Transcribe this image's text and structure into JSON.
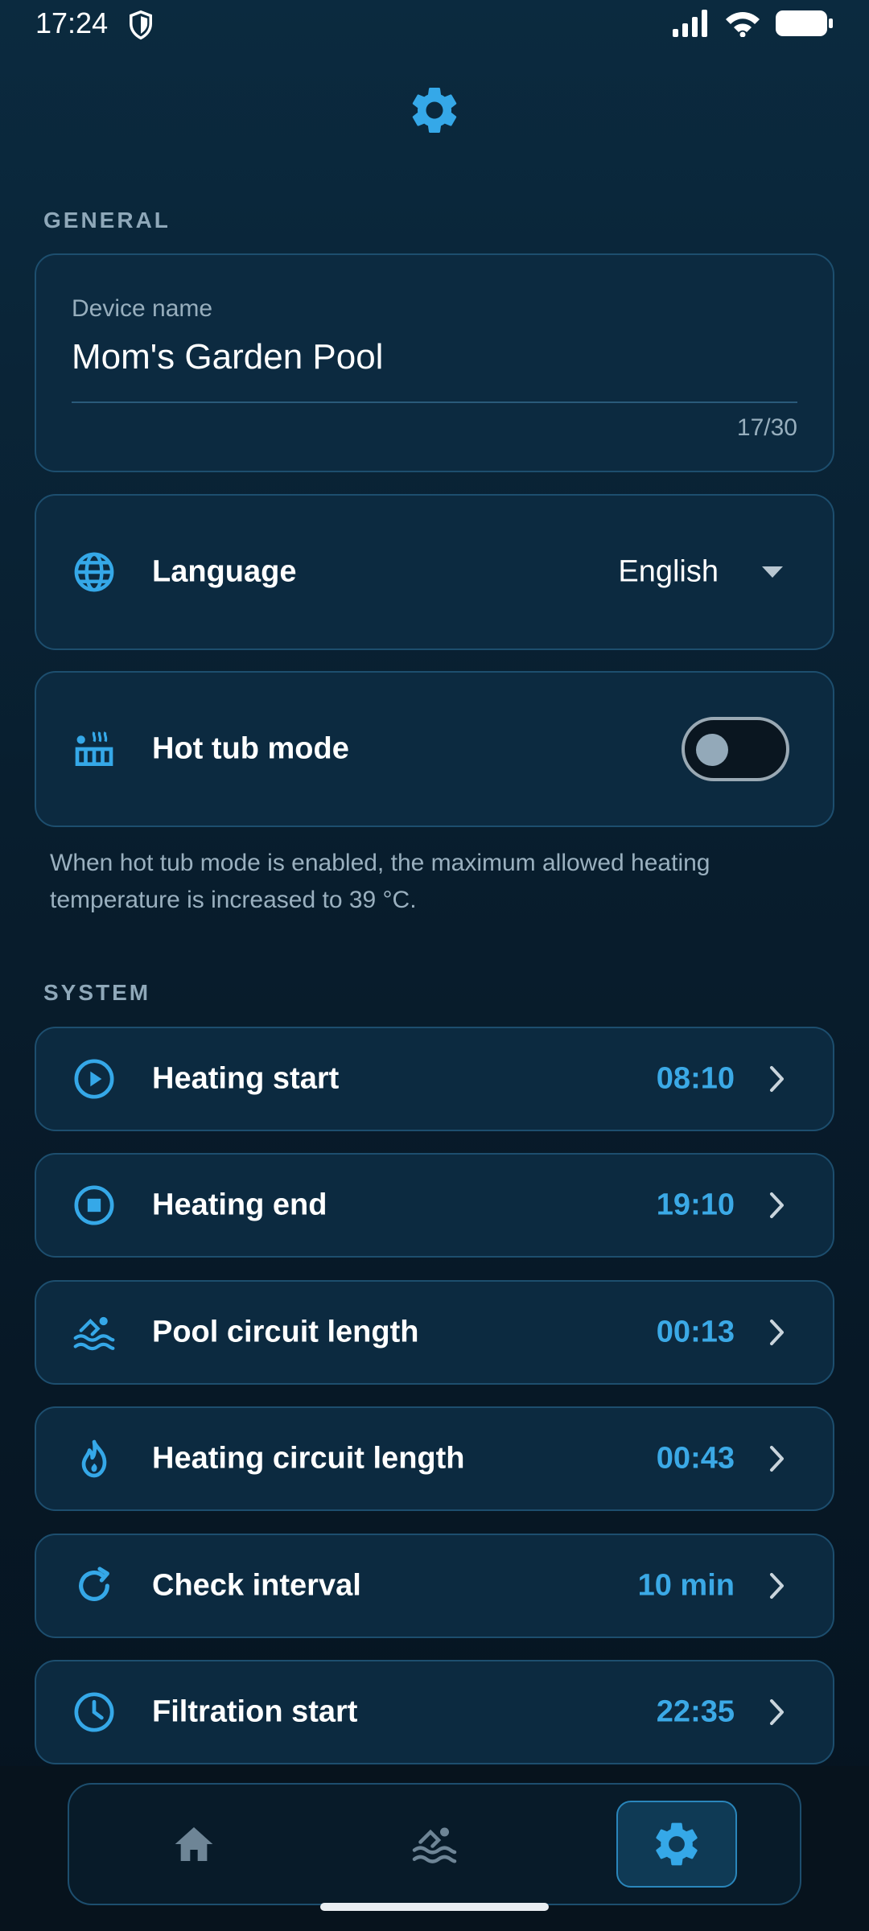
{
  "status_bar": {
    "time": "17:24"
  },
  "general": {
    "section_label": "GENERAL",
    "device_name": {
      "label": "Device name",
      "value": "Mom's Garden Pool",
      "counter": "17/30"
    },
    "language": {
      "label": "Language",
      "value": "English",
      "icon": "globe-icon"
    },
    "hot_tub": {
      "label": "Hot tub mode",
      "enabled": false,
      "icon": "hot-tub-icon",
      "help": "When hot tub mode is enabled, the maximum allowed heating temperature is increased to 39 °C."
    }
  },
  "system": {
    "section_label": "SYSTEM",
    "items": [
      {
        "label": "Heating start",
        "value": "08:10",
        "icon": "play-circle-icon"
      },
      {
        "label": "Heating end",
        "value": "19:10",
        "icon": "stop-circle-icon"
      },
      {
        "label": "Pool circuit length",
        "value": "00:13",
        "icon": "swimmer-icon"
      },
      {
        "label": "Heating circuit length",
        "value": "00:43",
        "icon": "flame-icon"
      },
      {
        "label": "Check interval",
        "value": "10 min",
        "icon": "refresh-icon"
      },
      {
        "label": "Filtration start",
        "value": "22:35",
        "icon": "clock-icon"
      }
    ]
  },
  "bottom_nav": {
    "items": [
      {
        "icon": "home-icon",
        "active": false
      },
      {
        "icon": "pool-icon",
        "active": false
      },
      {
        "icon": "gear-icon",
        "active": true
      }
    ]
  },
  "colors": {
    "accent": "#3ba9e6",
    "card": "#0c2a40",
    "card_border": "#1d4e6e"
  }
}
